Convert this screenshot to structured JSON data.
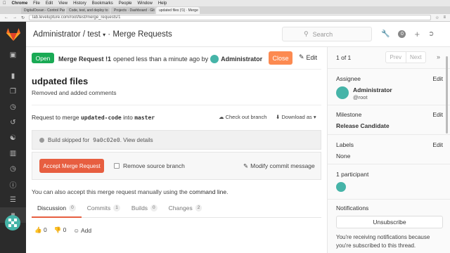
{
  "macos": {
    "app": "Chrome",
    "menus": [
      "File",
      "Edit",
      "View",
      "History",
      "Bookmarks",
      "People",
      "Window",
      "Help"
    ]
  },
  "browser": {
    "tabs": [
      {
        "label": "DigitalOcean - Control Pan"
      },
      {
        "label": "Code, test, and deploy to"
      },
      {
        "label": "Projects · Dashboard · Git"
      },
      {
        "label": "updated files (!1) · Merge"
      }
    ],
    "url": "lab.levelupture.com/root/test/merge_requests/1"
  },
  "header": {
    "breadcrumb": "Administrator / test",
    "section": "· Merge Requests",
    "search_placeholder": "Search",
    "todo_count": "0"
  },
  "mr": {
    "status": "Open",
    "title_ref": "Merge Request !1",
    "opened_text": "opened less than a minute ago by",
    "author": "Administrator",
    "close_label": "Close",
    "edit_label": "Edit",
    "title": "udpated files",
    "description": "Removed and added comments",
    "request_prefix": "Request to merge",
    "source_branch": "updated-code",
    "into": "into",
    "target_branch": "master",
    "checkout_label": "Check out branch",
    "download_label": "Download as",
    "build_prefix": "Build skipped for",
    "build_sha": "9a0c02e0",
    "build_link": ". View details",
    "accept_label": "Accept Merge Request",
    "remove_source_label": "Remove source branch",
    "modify_commit_label": "Modify commit message",
    "manual_text": "You can also accept this merge request manually using the",
    "manual_link": "command line",
    "manual_end": "."
  },
  "tabs": [
    {
      "label": "Discussion",
      "count": "0"
    },
    {
      "label": "Commits",
      "count": "1"
    },
    {
      "label": "Builds",
      "count": "0"
    },
    {
      "label": "Changes",
      "count": "2"
    }
  ],
  "reactions": {
    "thumbs_up": "0",
    "thumbs_down": "0",
    "add_label": "Add"
  },
  "sidebar": {
    "pager": "1 of 1",
    "prev": "Prev",
    "next": "Next",
    "assignee_label": "Assignee",
    "assignee_edit": "Edit",
    "assignee_name": "Administrator",
    "assignee_user": "@root",
    "milestone_label": "Milestone",
    "milestone_edit": "Edit",
    "milestone_value": "Release Candidate",
    "labels_label": "Labels",
    "labels_edit": "Edit",
    "labels_value": "None",
    "participants_label": "1 participant",
    "notifications_label": "Notifications",
    "unsubscribe_label": "Unsubscribe",
    "notif_text": "You're receiving notifications because you're subscribed to this thread."
  },
  "colors": {
    "open_green": "#1aaa55",
    "close_orange": "#fc8a51",
    "accept_red": "#e75e40",
    "sidebar_dark": "#2b2b2b",
    "avatar_teal": "#46b4a8"
  }
}
